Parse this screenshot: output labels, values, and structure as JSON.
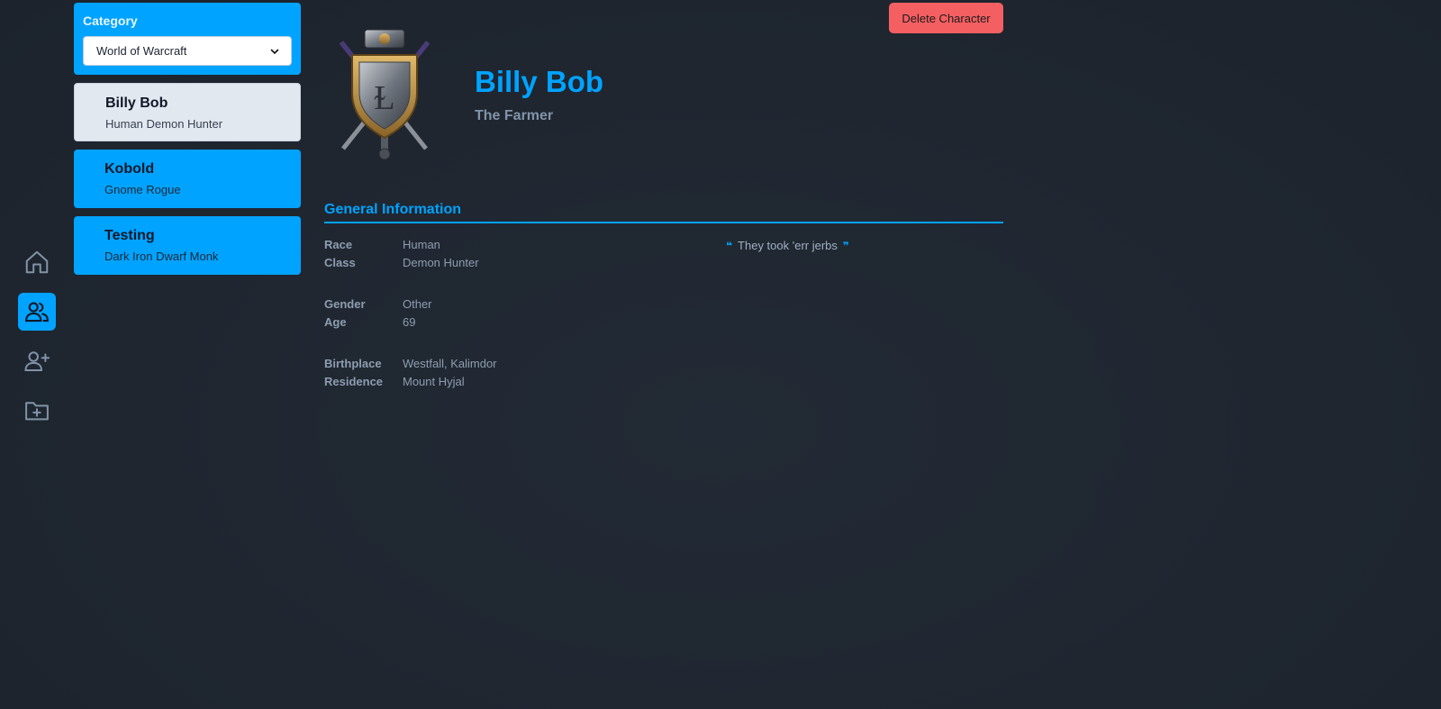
{
  "category": {
    "label": "Category",
    "selected": "World of Warcraft"
  },
  "characters": [
    {
      "name": "Billy Bob",
      "subtitle": "Human Demon Hunter"
    },
    {
      "name": "Kobold",
      "subtitle": "Gnome Rogue"
    },
    {
      "name": "Testing",
      "subtitle": "Dark Iron Dwarf Monk"
    }
  ],
  "actions": {
    "delete_label": "Delete Character"
  },
  "character": {
    "name": "Billy Bob",
    "title": "The Farmer",
    "quote": "They took 'err jerbs"
  },
  "section": {
    "general_title": "General Information"
  },
  "info": {
    "race_label": "Race",
    "race": "Human",
    "class_label": "Class",
    "class": "Demon Hunter",
    "gender_label": "Gender",
    "gender": "Other",
    "age_label": "Age",
    "age": "69",
    "birthplace_label": "Birthplace",
    "birthplace": "Westfall, Kalimdor",
    "residence_label": "Residence",
    "residence": "Mount Hyjal"
  },
  "colors": {
    "accent": "#00a3ff",
    "danger": "#f45f62",
    "background": "#202731",
    "muted_text": "#8e9db0"
  },
  "icons": {
    "rail": [
      "home-icon",
      "users-icon",
      "user-plus-icon",
      "folder-plus-icon"
    ],
    "emblem": "alliance-crest-icon"
  }
}
